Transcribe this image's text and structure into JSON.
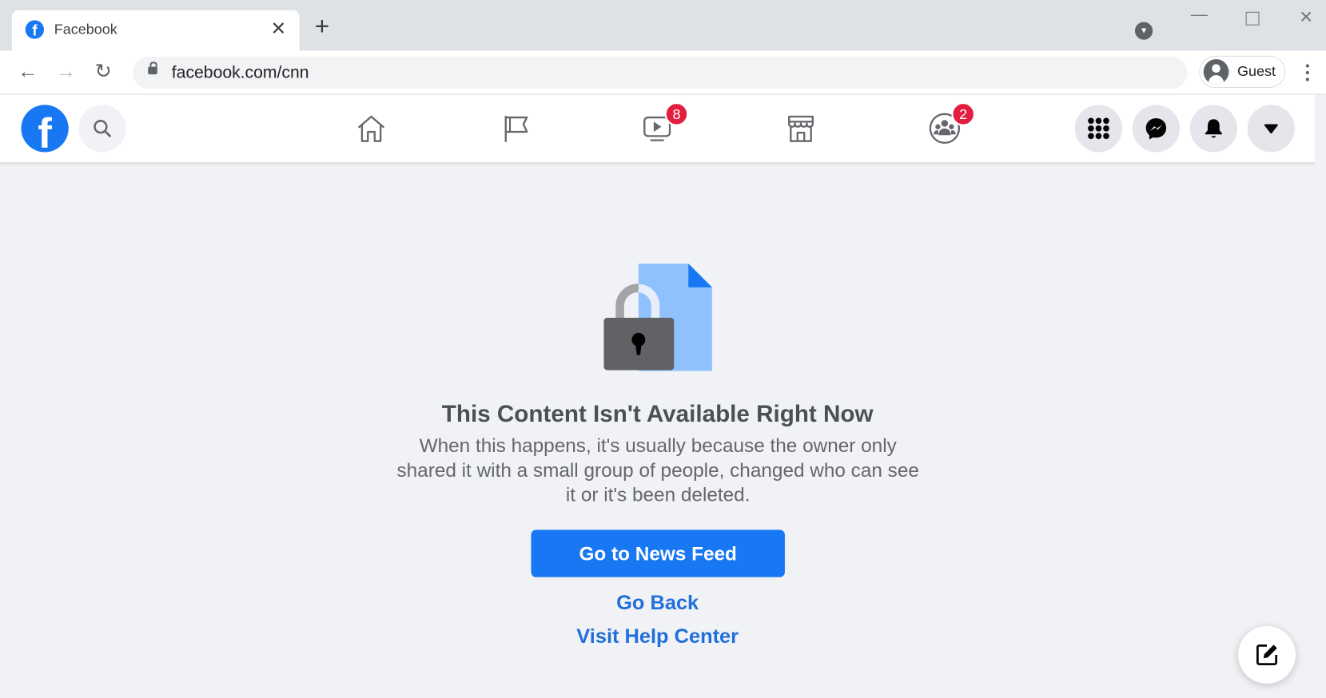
{
  "browser": {
    "tab_title": "Facebook",
    "new_tab_label": "+",
    "url": "facebook.com/cnn",
    "profile_label": "Guest"
  },
  "facebook": {
    "nav": [
      {
        "name": "home",
        "icon": "home-icon"
      },
      {
        "name": "pages",
        "icon": "flag-icon"
      },
      {
        "name": "watch",
        "icon": "video-icon",
        "badge": "8"
      },
      {
        "name": "marketplace",
        "icon": "store-icon"
      },
      {
        "name": "groups",
        "icon": "groups-icon",
        "badge": "2"
      }
    ],
    "accent": "#1877f2",
    "badge_color": "#e41e3f"
  },
  "main": {
    "title": "This Content Isn't Available Right Now",
    "description": "When this happens, it's usually because the owner only shared it with a small group of people, changed who can see it or it's been deleted.",
    "primary_button": "Go to News Feed",
    "go_back": "Go Back",
    "help_center": "Visit Help Center"
  }
}
